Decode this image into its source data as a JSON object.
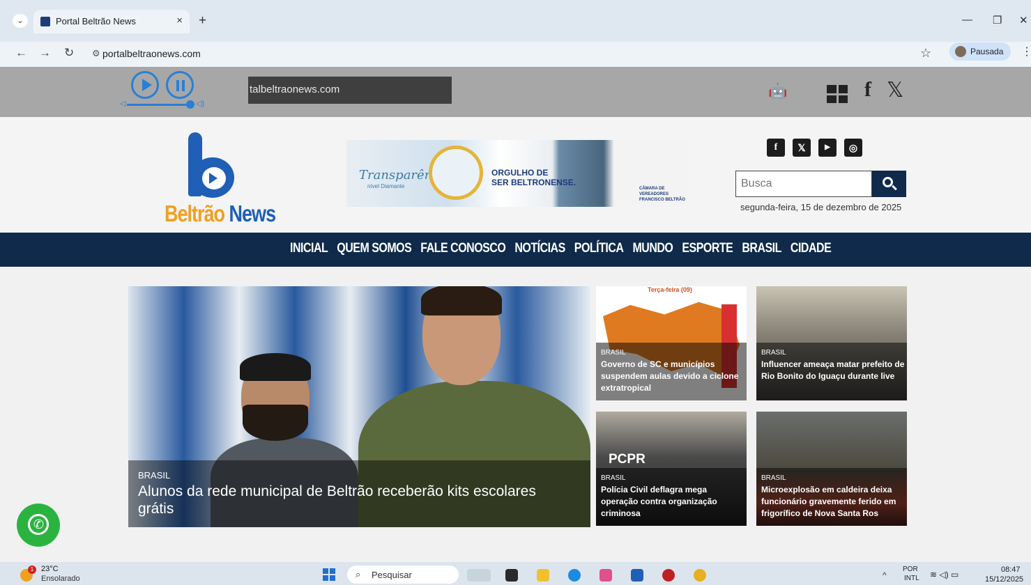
{
  "browser": {
    "tab_title": "Portal Beltrão News",
    "tab_close": "×",
    "new_tab": "+",
    "url": "portalbeltraonews.com",
    "profile_label": "Pausada",
    "star": "☆",
    "kebab": "⋮"
  },
  "player": {
    "marquee_text": "talbeltraonews.com"
  },
  "header": {
    "logo_main": "Beltrão",
    "logo_accent": "News",
    "banner_script": "Transparência",
    "banner_sub": "nível Diamante",
    "banner_slogan_1": "ORGULHO DE",
    "banner_slogan_2": "SER BELTRONENSE.",
    "banner_org_1": "CÂMARA DE VEREADORES",
    "banner_org_2": "FRANCISCO BELTRÃO",
    "search_placeholder": "Busca",
    "date": "segunda-feira, 15 de dezembro de 2025",
    "social_icons": [
      "facebook-icon",
      "x-icon",
      "youtube-icon",
      "instagram-icon"
    ]
  },
  "nav": {
    "items": [
      "INICIAL",
      "QUEM SOMOS",
      "FALE CONOSCO",
      "NOTÍCIAS",
      "POLÍTICA",
      "MUNDO",
      "ESPORTE",
      "BRASIL",
      "CIDADE"
    ]
  },
  "featured": {
    "category": "BRASIL",
    "title": "Alunos da rede municipal de Beltrão receberão kits escolares grátis"
  },
  "cards": [
    {
      "category": "BRASIL",
      "title": "Governo de SC e municípios suspendem aulas devido a ciclone extratropical",
      "image_text": "Terça-feira (09)"
    },
    {
      "category": "BRASIL",
      "title": "Influencer ameaça matar prefeito de Rio Bonito do Iguaçu durante live"
    },
    {
      "category": "BRASIL",
      "title": "Polícia Civil deflagra mega operação contra organização criminosa",
      "image_text": "PCPR"
    },
    {
      "category": "BRASIL",
      "title": "Microexplosão em caldeira deixa funcionário gravemente ferido em frigorífico de Nova Santa Ros"
    }
  ],
  "taskbar": {
    "weather_badge": "1",
    "temperature": "23°C",
    "weather": "Ensolarado",
    "search_label": "Pesquisar",
    "lang_1": "POR",
    "lang_2": "INTL",
    "time": "08:47",
    "date": "15/12/2025"
  },
  "colors": {
    "nav_bg": "#0f2a4a",
    "player_bg": "#a7a7a7",
    "accent_blue": "#2a7fd4",
    "whatsapp": "#2bb340"
  }
}
